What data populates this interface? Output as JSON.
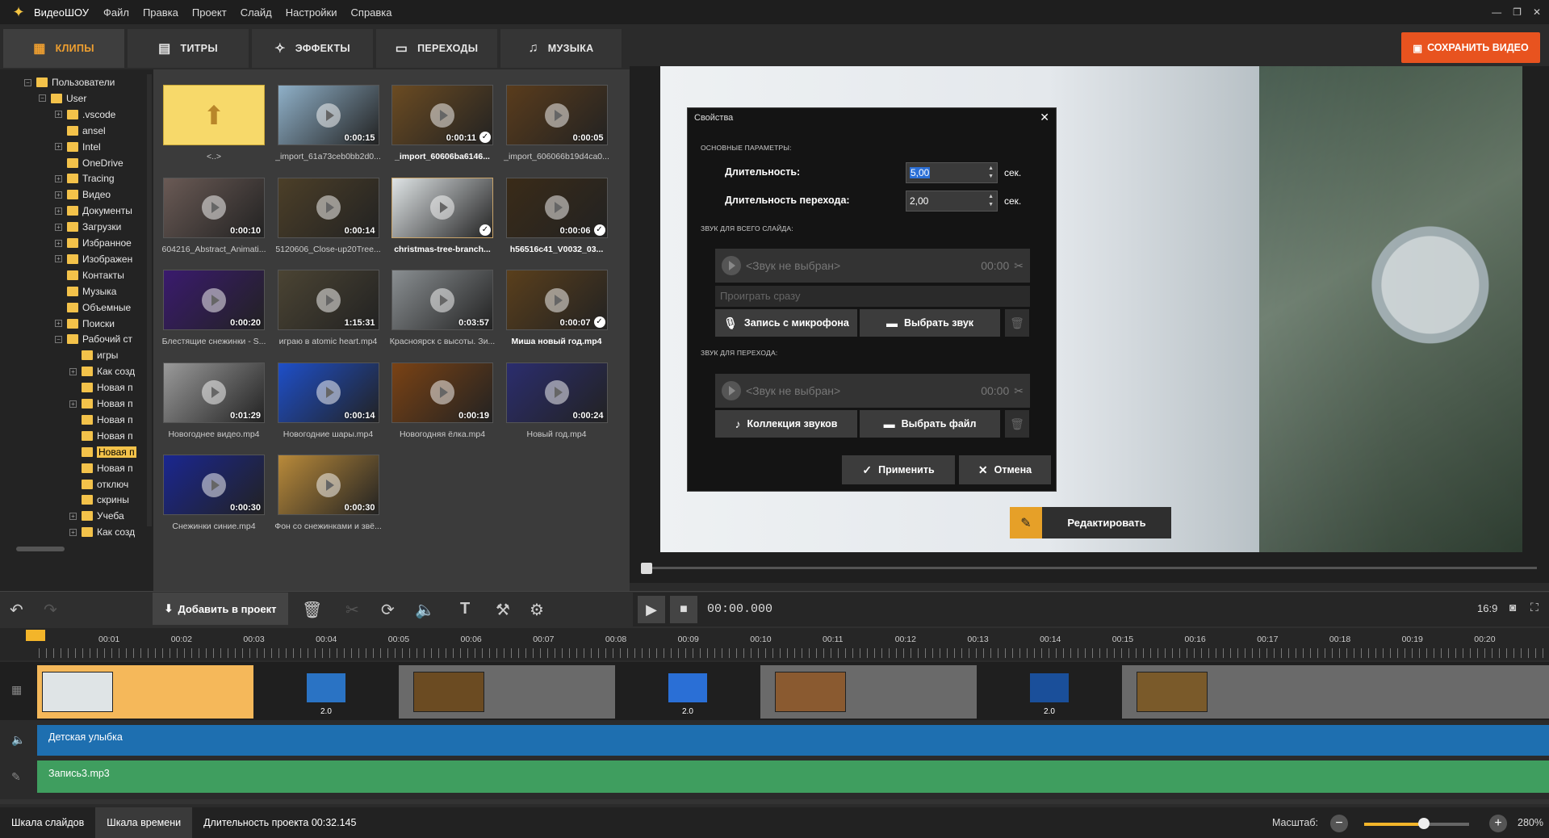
{
  "app": {
    "name": "ВидеоШОУ",
    "menu": [
      "Файл",
      "Правка",
      "Проект",
      "Слайд",
      "Настройки",
      "Справка"
    ]
  },
  "tabs": [
    {
      "label": "КЛИПЫ",
      "icon": "film-icon"
    },
    {
      "label": "ТИТРЫ",
      "icon": "titles-icon"
    },
    {
      "label": "ЭФФЕКТЫ",
      "icon": "effects-icon"
    },
    {
      "label": "ПЕРЕХОДЫ",
      "icon": "transitions-icon"
    },
    {
      "label": "МУЗЫКА",
      "icon": "music-icon"
    }
  ],
  "save_button": "СОХРАНИТЬ ВИДЕО",
  "tree": [
    {
      "label": "Пользователи",
      "depth": 0,
      "exp": "−"
    },
    {
      "label": "User",
      "depth": 1,
      "exp": "−"
    },
    {
      "label": ".vscode",
      "depth": 2,
      "exp": "+"
    },
    {
      "label": "ansel",
      "depth": 2,
      "exp": ""
    },
    {
      "label": "Intel",
      "depth": 2,
      "exp": "+"
    },
    {
      "label": "OneDrive",
      "depth": 2,
      "exp": ""
    },
    {
      "label": "Tracing",
      "depth": 2,
      "exp": "+"
    },
    {
      "label": "Видео",
      "depth": 2,
      "exp": "+"
    },
    {
      "label": "Документы",
      "depth": 2,
      "exp": "+"
    },
    {
      "label": "Загрузки",
      "depth": 2,
      "exp": "+"
    },
    {
      "label": "Избранное",
      "depth": 2,
      "exp": "+"
    },
    {
      "label": "Изображен",
      "depth": 2,
      "exp": "+"
    },
    {
      "label": "Контакты",
      "depth": 2,
      "exp": ""
    },
    {
      "label": "Музыка",
      "depth": 2,
      "exp": ""
    },
    {
      "label": "Объемные",
      "depth": 2,
      "exp": ""
    },
    {
      "label": "Поиски",
      "depth": 2,
      "exp": "+"
    },
    {
      "label": "Рабочий ст",
      "depth": 2,
      "exp": "−"
    },
    {
      "label": "игры",
      "depth": 3,
      "exp": ""
    },
    {
      "label": "Как созд",
      "depth": 3,
      "exp": "+"
    },
    {
      "label": "Новая п",
      "depth": 3,
      "exp": ""
    },
    {
      "label": "Новая п",
      "depth": 3,
      "exp": "+"
    },
    {
      "label": "Новая п",
      "depth": 3,
      "exp": ""
    },
    {
      "label": "Новая п",
      "depth": 3,
      "exp": ""
    },
    {
      "label": "Новая п",
      "depth": 3,
      "exp": "",
      "selected": true
    },
    {
      "label": "Новая п",
      "depth": 3,
      "exp": ""
    },
    {
      "label": "отключ",
      "depth": 3,
      "exp": ""
    },
    {
      "label": "скрины",
      "depth": 3,
      "exp": ""
    },
    {
      "label": "Учеба",
      "depth": 3,
      "exp": "+"
    },
    {
      "label": "Как созд",
      "depth": 3,
      "exp": "+"
    }
  ],
  "media": [
    {
      "name": "<..>",
      "dur": "",
      "folder": true
    },
    {
      "name": "_import_61a73ceb0bb2d0...",
      "dur": "0:00:15",
      "bg": "#8fb0c8"
    },
    {
      "name": "_import_60606ba6146...",
      "dur": "0:00:11",
      "bg": "#6b4b22",
      "check": true,
      "bold": true
    },
    {
      "name": "_import_606066b19d4ca0...",
      "dur": "0:00:05",
      "bg": "#5a3c1c"
    },
    {
      "name": "604216_Abstract_Animati...",
      "dur": "0:00:10",
      "bg": "#6a5a55"
    },
    {
      "name": "5120606_Close-up20Tree...",
      "dur": "0:00:14",
      "bg": "#4c3f28"
    },
    {
      "name": "christmas-tree-branch...",
      "dur": "",
      "bg": "#dfe4e6",
      "check": true,
      "bold": true,
      "selected": true
    },
    {
      "name": "h56516c41_V0032_03...",
      "dur": "0:00:06",
      "bg": "#3a2b18",
      "check": true,
      "bold": true
    },
    {
      "name": "Блестящие снежинки - S...",
      "dur": "0:00:20",
      "bg": "#3a1a6e"
    },
    {
      "name": "играю в atomic heart.mp4",
      "dur": "1:15:31",
      "bg": "#4b4433"
    },
    {
      "name": "Красноярск с высоты. Зи...",
      "dur": "0:03:57",
      "bg": "#8a8f92"
    },
    {
      "name": "Миша новый год.mp4",
      "dur": "0:00:07",
      "bg": "#5a3f1c",
      "check": true,
      "bold": true
    },
    {
      "name": "Новогоднее видео.mp4",
      "dur": "0:01:29",
      "bg": "#9a9a9a"
    },
    {
      "name": "Новогодние шары.mp4",
      "dur": "0:00:14",
      "bg": "#1e4fc9"
    },
    {
      "name": "Новогодняя ёлка.mp4",
      "dur": "0:00:19",
      "bg": "#7a4214"
    },
    {
      "name": "Новый год.mp4",
      "dur": "0:00:24",
      "bg": "#2b2d6e"
    },
    {
      "name": "Снежинки синие.mp4",
      "dur": "0:00:30",
      "bg": "#1a2690"
    },
    {
      "name": "Фон со снежинками и звё...",
      "dur": "0:00:30",
      "bg": "#b98a3a"
    }
  ],
  "dialog": {
    "title": "Свойства",
    "section_main": "ОСНОВНЫЕ ПАРАМЕТРЫ:",
    "duration_label": "Длительность:",
    "duration_value": "5,00",
    "transition_label": "Длительность перехода:",
    "transition_value": "2,00",
    "unit": "сек.",
    "section_slide_sound": "ЗВУК ДЛЯ ВСЕГО СЛАЙДА:",
    "no_sound": "<Звук не выбран>",
    "sound_time": "00:00",
    "play_mode": "Проиграть сразу",
    "mic_button": "Запись с микрофона",
    "choose_sound": "Выбрать звук",
    "section_trans_sound": "ЗВУК ДЛЯ ПЕРЕХОДА:",
    "collection_button": "Коллекция звуков",
    "choose_file": "Выбрать файл",
    "apply": "Применить",
    "cancel": "Отмена"
  },
  "edit_button": "Редактировать",
  "toolbar": {
    "add": "Добавить в проект",
    "time": "00:00.000",
    "ratio": "16:9"
  },
  "ruler": [
    "00:01",
    "00:02",
    "00:03",
    "00:04",
    "00:05",
    "00:06",
    "00:07",
    "00:08",
    "00:09",
    "00:10",
    "00:11",
    "00:12",
    "00:13",
    "00:14",
    "00:15",
    "00:16",
    "00:17",
    "00:18",
    "00:19",
    "00:20"
  ],
  "transition_label": "2.0",
  "audio_tracks": [
    "Детская улыбка",
    "Запись3.mp3"
  ],
  "status": {
    "slides": "Шкала слайдов",
    "timeline": "Шкала времени",
    "duration": "Длительность проекта 00:32.145",
    "zoom_label": "Масштаб:",
    "zoom_value": "280%",
    "zoom_level_percent": 57
  }
}
